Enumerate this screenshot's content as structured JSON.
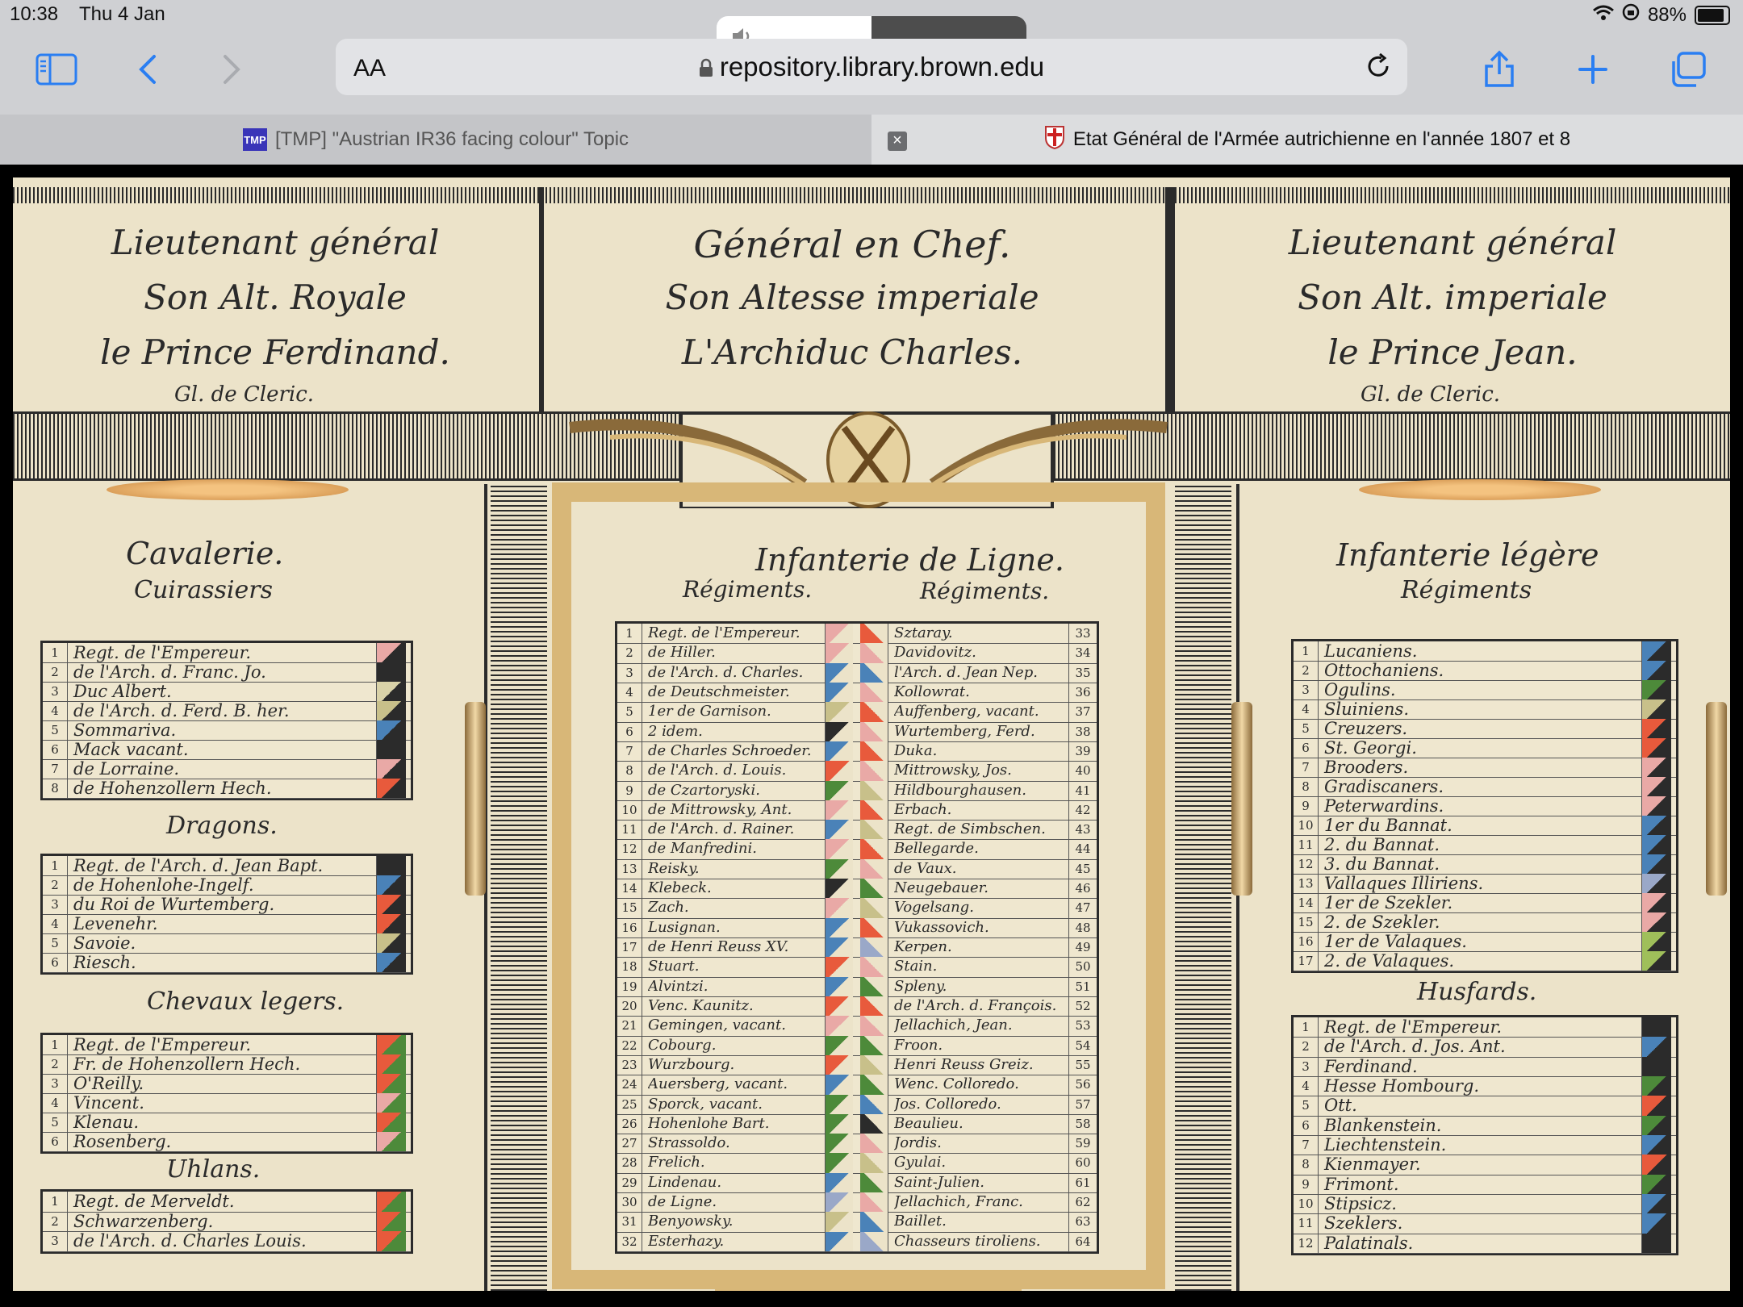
{
  "status_bar": {
    "time": "10:38",
    "date": "Thu 4 Jan",
    "battery": "88%",
    "battery_level": 0.88
  },
  "volume_hud": {
    "level": 0.5,
    "icon": "speaker-icon"
  },
  "address_bar": {
    "reader_label": "AA",
    "url": "repository.library.brown.edu"
  },
  "tabs": [
    {
      "favicon": "TMP",
      "title": "[TMP] \"Austrian IR36 facing colour\" Topic",
      "active": false
    },
    {
      "favicon": "crest",
      "title": "Etat Général de l'Armée autrichienne en l'année 1807 et 8",
      "active": true
    }
  ],
  "document": {
    "left_header": {
      "lines": [
        "Lieutenant général",
        "Son Alt. Royale",
        "le Prince Ferdinand."
      ],
      "sign": "Gl. de Cleric."
    },
    "center_header": {
      "lines": [
        "Général en Chef.",
        "Son Altesse imperiale",
        "L'Archiduc Charles."
      ]
    },
    "right_header": {
      "lines": [
        "Lieutenant général",
        "Son Alt. imperiale",
        "le Prince Jean."
      ],
      "sign": "Gl. de Cleric."
    },
    "cavalry": {
      "title": "Cavalerie.",
      "cuirassiers": {
        "title": "Cuirassiers",
        "rows": [
          {
            "n": "1",
            "name": "Regt. de l'Empereur.",
            "c": [
              "#e9a9a6",
              "#2b2b2b"
            ]
          },
          {
            "n": "2",
            "name": "de l'Arch. d. Franc. Jo.",
            "c": [
              "#2b2b2b",
              "#2b2b2b"
            ]
          },
          {
            "n": "3",
            "name": "Duc Albert.",
            "c": [
              "#d9d2a8",
              "#2b2b2b"
            ]
          },
          {
            "n": "4",
            "name": "de l'Arch. d. Ferd. B. her.",
            "c": [
              "#c8c08a",
              "#2b2b2b"
            ]
          },
          {
            "n": "5",
            "name": "Sommariva.",
            "c": [
              "#4a82b8",
              "#2b2b2b"
            ]
          },
          {
            "n": "6",
            "name": "Mack vacant.",
            "c": [
              "#2b2b2b",
              "#2b2b2b"
            ]
          },
          {
            "n": "7",
            "name": "de Lorraine.",
            "c": [
              "#e9a9a6",
              "#2b2b2b"
            ]
          },
          {
            "n": "8",
            "name": "de Hohenzollern Hech.",
            "c": [
              "#e85a3c",
              "#2b2b2b"
            ]
          }
        ]
      },
      "dragoons": {
        "title": "Dragons.",
        "rows": [
          {
            "n": "1",
            "name": "Regt. de l'Arch. d. Jean Bapt.",
            "c": [
              "#2b2b2b",
              "#2b2b2b"
            ]
          },
          {
            "n": "2",
            "name": "de Hohenlohe-Ingelf.",
            "c": [
              "#4a82b8",
              "#2b2b2b"
            ]
          },
          {
            "n": "3",
            "name": "du Roi de Wurtemberg.",
            "c": [
              "#e85a3c",
              "#2b2b2b"
            ]
          },
          {
            "n": "4",
            "name": "Levenehr.",
            "c": [
              "#e85a3c",
              "#2b2b2b"
            ]
          },
          {
            "n": "5",
            "name": "Savoie.",
            "c": [
              "#c8c08a",
              "#2b2b2b"
            ]
          },
          {
            "n": "6",
            "name": "Riesch.",
            "c": [
              "#4a82b8",
              "#2b2b2b"
            ]
          }
        ]
      },
      "chevaux": {
        "title": "Chevaux legers.",
        "rows": [
          {
            "n": "1",
            "name": "Regt. de l'Empereur.",
            "c": [
              "#e85a3c",
              "#4d8a3a"
            ]
          },
          {
            "n": "2",
            "name": "Fr. de Hohenzollern Hech.",
            "c": [
              "#e85a3c",
              "#4d8a3a"
            ]
          },
          {
            "n": "3",
            "name": "O'Reilly.",
            "c": [
              "#e85a3c",
              "#4d8a3a"
            ]
          },
          {
            "n": "4",
            "name": "Vincent.",
            "c": [
              "#e9a9a6",
              "#4d8a3a"
            ]
          },
          {
            "n": "5",
            "name": "Klenau.",
            "c": [
              "#e85a3c",
              "#4d8a3a"
            ]
          },
          {
            "n": "6",
            "name": "Rosenberg.",
            "c": [
              "#e9a9a6",
              "#4d8a3a"
            ]
          }
        ]
      },
      "uhlans": {
        "title": "Uhlans.",
        "rows": [
          {
            "n": "1",
            "name": "Regt. de Merveldt.",
            "c": [
              "#e85a3c",
              "#4d8a3a"
            ]
          },
          {
            "n": "2",
            "name": "Schwarzenberg.",
            "c": [
              "#e85a3c",
              "#4d8a3a"
            ]
          },
          {
            "n": "3",
            "name": "de l'Arch. d. Charles Louis.",
            "c": [
              "#e85a3c",
              "#4d8a3a"
            ]
          }
        ]
      }
    },
    "line_infantry": {
      "title": "Infanterie de Ligne.",
      "col_header_left": "Régiments.",
      "col_header_right": "Régiments.",
      "rows": [
        {
          "l": "1",
          "ln": "Regt. de l'Empereur.",
          "lc": "#e9a9a6",
          "rn": "33",
          "rname": "Sztaray.",
          "rc": "#e85a3c"
        },
        {
          "l": "2",
          "ln": "de Hiller.",
          "lc": "#e9a9a6",
          "rn": "34",
          "rname": "Davidovitz.",
          "rc": "#e9a9a6"
        },
        {
          "l": "3",
          "ln": "de l'Arch. d. Charles.",
          "lc": "#4a82b8",
          "rn": "35",
          "rname": "l'Arch. d. Jean Nep.",
          "rc": "#4a82b8"
        },
        {
          "l": "4",
          "ln": "de Deutschmeister.",
          "lc": "#4a82b8",
          "rn": "36",
          "rname": "Kollowrat.",
          "rc": "#e9a9a6"
        },
        {
          "l": "5",
          "ln": "1er de Garnison.",
          "lc": "#c8c08a",
          "rn": "37",
          "rname": "Auffenberg, vacant.",
          "rc": "#e85a3c"
        },
        {
          "l": "6",
          "ln": "2 idem.",
          "lc": "#2b2b2b",
          "rn": "38",
          "rname": "Wurtemberg, Ferd.",
          "rc": "#e9a9a6"
        },
        {
          "l": "7",
          "ln": "de Charles Schroeder.",
          "lc": "#4a82b8",
          "rn": "39",
          "rname": "Duka.",
          "rc": "#e85a3c"
        },
        {
          "l": "8",
          "ln": "de l'Arch. d. Louis.",
          "lc": "#e85a3c",
          "rn": "40",
          "rname": "Mittrowsky, Jos.",
          "rc": "#e9a9a6"
        },
        {
          "l": "9",
          "ln": "de Czartoryski.",
          "lc": "#4d8a3a",
          "rn": "41",
          "rname": "Hildbourghausen.",
          "rc": "#c8c08a"
        },
        {
          "l": "10",
          "ln": "de Mittrowsky, Ant.",
          "lc": "#e9a9a6",
          "rn": "42",
          "rname": "Erbach.",
          "rc": "#e85a3c"
        },
        {
          "l": "11",
          "ln": "de l'Arch. d. Rainer.",
          "lc": "#4a82b8",
          "rn": "43",
          "rname": "Regt. de Simbschen.",
          "rc": "#c8c08a"
        },
        {
          "l": "12",
          "ln": "de Manfredini.",
          "lc": "#e9a9a6",
          "rn": "44",
          "rname": "Bellegarde.",
          "rc": "#e85a3c"
        },
        {
          "l": "13",
          "ln": "Reisky.",
          "lc": "#4d8a3a",
          "rn": "45",
          "rname": "de Vaux.",
          "rc": "#e9a9a6"
        },
        {
          "l": "14",
          "ln": "Klebeck.",
          "lc": "#2b2b2b",
          "rn": "46",
          "rname": "Neugebauer.",
          "rc": "#4d8a3a"
        },
        {
          "l": "15",
          "ln": "Zach.",
          "lc": "#e9a9a6",
          "rn": "47",
          "rname": "Vogelsang.",
          "rc": "#c8c08a"
        },
        {
          "l": "16",
          "ln": "Lusignan.",
          "lc": "#4a82b8",
          "rn": "48",
          "rname": "Vukassovich.",
          "rc": "#e85a3c"
        },
        {
          "l": "17",
          "ln": "de Henri Reuss XV.",
          "lc": "#4a82b8",
          "rn": "49",
          "rname": "Kerpen.",
          "rc": "#9aa8c8"
        },
        {
          "l": "18",
          "ln": "Stuart.",
          "lc": "#e85a3c",
          "rn": "50",
          "rname": "Stain.",
          "rc": "#e9a9a6"
        },
        {
          "l": "19",
          "ln": "Alvintzi.",
          "lc": "#4a82b8",
          "rn": "51",
          "rname": "Spleny.",
          "rc": "#4d8a3a"
        },
        {
          "l": "20",
          "ln": "Venc. Kaunitz.",
          "lc": "#e85a3c",
          "rn": "52",
          "rname": "de l'Arch. d. François.",
          "rc": "#e85a3c"
        },
        {
          "l": "21",
          "ln": "Gemingen, vacant.",
          "lc": "#e9a9a6",
          "rn": "53",
          "rname": "Jellachich, Jean.",
          "rc": "#e9a9a6"
        },
        {
          "l": "22",
          "ln": "Cobourg.",
          "lc": "#4d8a3a",
          "rn": "54",
          "rname": "Froon.",
          "rc": "#4d8a3a"
        },
        {
          "l": "23",
          "ln": "Wurzbourg.",
          "lc": "#e85a3c",
          "rn": "55",
          "rname": "Henri Reuss Greiz.",
          "rc": "#c8c08a"
        },
        {
          "l": "24",
          "ln": "Auersberg, vacant.",
          "lc": "#4a82b8",
          "rn": "56",
          "rname": "Wenc. Colloredo.",
          "rc": "#4d8a3a"
        },
        {
          "l": "25",
          "ln": "Sporck, vacant.",
          "lc": "#4d8a3a",
          "rn": "57",
          "rname": "Jos. Colloredo.",
          "rc": "#4a82b8"
        },
        {
          "l": "26",
          "ln": "Hohenlohe Bart.",
          "lc": "#4d8a3a",
          "rn": "58",
          "rname": "Beaulieu.",
          "rc": "#2b2b2b"
        },
        {
          "l": "27",
          "ln": "Strassoldo.",
          "lc": "#4d8a3a",
          "rn": "59",
          "rname": "Jordis.",
          "rc": "#e9a9a6"
        },
        {
          "l": "28",
          "ln": "Frelich.",
          "lc": "#4d8a3a",
          "rn": "60",
          "rname": "Gyulai.",
          "rc": "#c8c08a"
        },
        {
          "l": "29",
          "ln": "Lindenau.",
          "lc": "#4a82b8",
          "rn": "61",
          "rname": "Saint-Julien.",
          "rc": "#4d8a3a"
        },
        {
          "l": "30",
          "ln": "de Ligne.",
          "lc": "#9aa8c8",
          "rn": "62",
          "rname": "Jellachich, Franc.",
          "rc": "#e9a9a6"
        },
        {
          "l": "31",
          "ln": "Benyowsky.",
          "lc": "#c8c08a",
          "rn": "63",
          "rname": "Baillet.",
          "rc": "#4a82b8"
        },
        {
          "l": "32",
          "ln": "Esterhazy.",
          "lc": "#4a82b8",
          "rn": "64",
          "rname": "Chasseurs tiroliens.",
          "rc": "#9aa8c8"
        }
      ]
    },
    "light_infantry": {
      "title": "Infanterie légère",
      "subtitle": "Régiments",
      "rows": [
        {
          "n": "1",
          "name": "Lucaniens.",
          "c": "#4a82b8"
        },
        {
          "n": "2",
          "name": "Ottochaniens.",
          "c": "#4a82b8"
        },
        {
          "n": "3",
          "name": "Ogulins.",
          "c": "#4d8a3a"
        },
        {
          "n": "4",
          "name": "Sluiniens.",
          "c": "#c8c08a"
        },
        {
          "n": "5",
          "name": "Creuzers.",
          "c": "#e85a3c"
        },
        {
          "n": "6",
          "name": "St. Georgi.",
          "c": "#e85a3c"
        },
        {
          "n": "7",
          "name": "Brooders.",
          "c": "#e9a9a6"
        },
        {
          "n": "8",
          "name": "Gradiscaners.",
          "c": "#e9a9a6"
        },
        {
          "n": "9",
          "name": "Peterwardins.",
          "c": "#e9a9a6"
        },
        {
          "n": "10",
          "name": "1er du Bannat.",
          "c": "#4a82b8"
        },
        {
          "n": "11",
          "name": "2. du Bannat.",
          "c": "#4a82b8"
        },
        {
          "n": "12",
          "name": "3. du Bannat.",
          "c": "#4a82b8"
        },
        {
          "n": "13",
          "name": "Vallaques Illiriens.",
          "c": "#9aa8c8"
        },
        {
          "n": "14",
          "name": "1er de Szekler.",
          "c": "#e9a9a6"
        },
        {
          "n": "15",
          "name": "2. de Szekler.",
          "c": "#e9a9a6"
        },
        {
          "n": "16",
          "name": "1er de Valaques.",
          "c": "#9fbf5a"
        },
        {
          "n": "17",
          "name": "2. de Valaques.",
          "c": "#9fbf5a"
        }
      ]
    },
    "hussars": {
      "title": "Husfards.",
      "rows": [
        {
          "n": "1",
          "name": "Regt. de l'Empereur.",
          "c": "#2b2b2b"
        },
        {
          "n": "2",
          "name": "de l'Arch. d. Jos. Ant.",
          "c": "#4a82b8"
        },
        {
          "n": "3",
          "name": "Ferdinand.",
          "c": "#2b2b2b"
        },
        {
          "n": "4",
          "name": "Hesse Hombourg.",
          "c": "#4d8a3a"
        },
        {
          "n": "5",
          "name": "Ott.",
          "c": "#e85a3c"
        },
        {
          "n": "6",
          "name": "Blankenstein.",
          "c": "#4d8a3a"
        },
        {
          "n": "7",
          "name": "Liechtenstein.",
          "c": "#4a82b8"
        },
        {
          "n": "8",
          "name": "Kienmayer.",
          "c": "#e85a3c"
        },
        {
          "n": "9",
          "name": "Frimont.",
          "c": "#4d8a3a"
        },
        {
          "n": "10",
          "name": "Stipsicz.",
          "c": "#4a82b8"
        },
        {
          "n": "11",
          "name": "Szeklers.",
          "c": "#4a82b8"
        },
        {
          "n": "12",
          "name": "Palatinals.",
          "c": "#2b2b2b"
        }
      ]
    }
  }
}
